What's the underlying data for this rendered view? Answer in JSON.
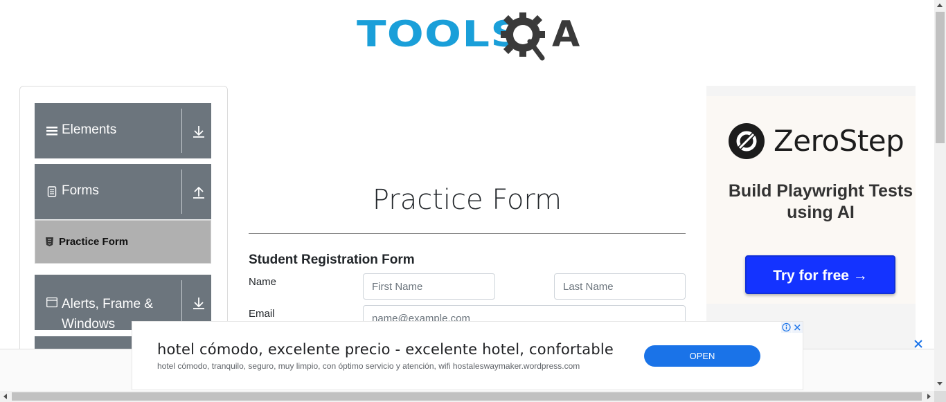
{
  "header": {
    "logo_text": "TOOLS",
    "logo_suffix": "A",
    "colors": {
      "logo_blue": "#1a9fd9",
      "logo_dark": "#3a3a3a"
    }
  },
  "sidebar": {
    "groups": [
      {
        "label": "Elements",
        "icon": "hamburger-icon",
        "arrow": "download-icon"
      },
      {
        "label": "Forms",
        "icon": "document-icon",
        "arrow": "upload-icon"
      },
      {
        "label": "Alerts, Frame & Windows",
        "icon": "window-icon",
        "arrow": "download-icon"
      }
    ],
    "sub_items": [
      {
        "label": "Practice Form",
        "icon": "html5-icon",
        "active": true
      }
    ],
    "colors": {
      "group_bg": "#6c757d",
      "active_bg": "#b0b0b0"
    }
  },
  "main": {
    "title": "Practice Form",
    "subtitle": "Student Registration Form",
    "fields": {
      "name_label": "Name",
      "first_name_placeholder": "First Name",
      "last_name_placeholder": "Last Name",
      "email_label": "Email",
      "email_placeholder": "name@example.com"
    }
  },
  "ad_right": {
    "brand": "ZeroStep",
    "tagline": "Build Playwright Tests using AI",
    "cta": "Try for free →",
    "colors": {
      "cta_bg": "#1433ff"
    }
  },
  "ad_bottom": {
    "headline": "hotel cómodo, excelente precio - excelente hotel, confortable",
    "description": "hotel cómodo, tranquilo, seguro, muy limpio, con óptimo servicio y atención, wifi hostaleswaymaker.wordpress.com",
    "cta": "OPEN",
    "colors": {
      "cta_bg": "#1a73e8"
    }
  }
}
